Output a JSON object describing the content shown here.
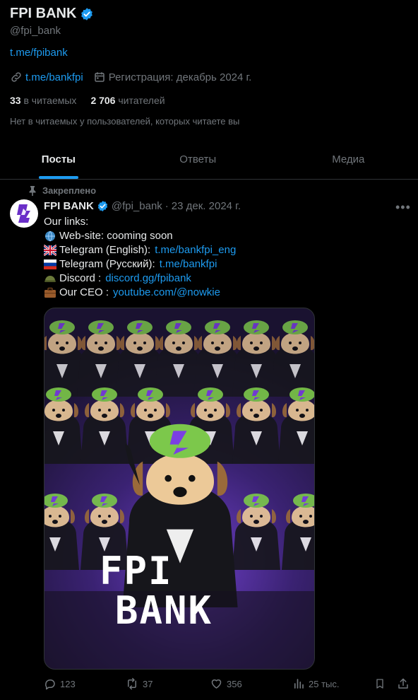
{
  "profile": {
    "name": "FPI BANK",
    "handle": "@fpi_bank",
    "bio_link": "t.me/fpibank",
    "website": "t.me/bankfpi",
    "joined": "Регистрация: декабрь 2024 г."
  },
  "stats": {
    "following_count": "33",
    "following_label": "в читаемых",
    "followers_count": "2 706",
    "followers_label": "читателей"
  },
  "followers_note": "Нет в читаемых у пользователей, которых читаете вы",
  "tabs": [
    {
      "label": "Посты"
    },
    {
      "label": "Ответы"
    },
    {
      "label": "Медиа"
    }
  ],
  "post": {
    "pinned_label": "Закреплено",
    "author_name": "FPI BANK",
    "author_handle": "@fpi_bank",
    "separator": "·",
    "date": "23 дек. 2024 г.",
    "lines": [
      {
        "text": "Our links:"
      },
      {
        "text": "Web-site: cooming soon",
        "emoji": "globe"
      },
      {
        "text": "Telegram (English): ",
        "link": "t.me/bankfpi_eng",
        "emoji": "uk-flag"
      },
      {
        "text": "Telegram (Русский): ",
        "link": "t.me/bankfpi",
        "emoji": "ru-flag"
      },
      {
        "text": "Discord : ",
        "link": "discord.gg/fpibank",
        "emoji": "helmet"
      },
      {
        "text": "Our CEO : ",
        "link": "youtube.com/@nowkie",
        "emoji": "briefcase"
      }
    ],
    "image_text_line1": "FPI",
    "image_text_line2": "BANK",
    "actions": {
      "replies": "123",
      "reposts": "37",
      "likes": "356",
      "views": "25 тыс."
    }
  },
  "colors": {
    "accent": "#1d9bf0",
    "background": "#000000",
    "muted": "#71767b",
    "hat_green": "#7cc84b",
    "brand_purple": "#7b3fe4"
  }
}
